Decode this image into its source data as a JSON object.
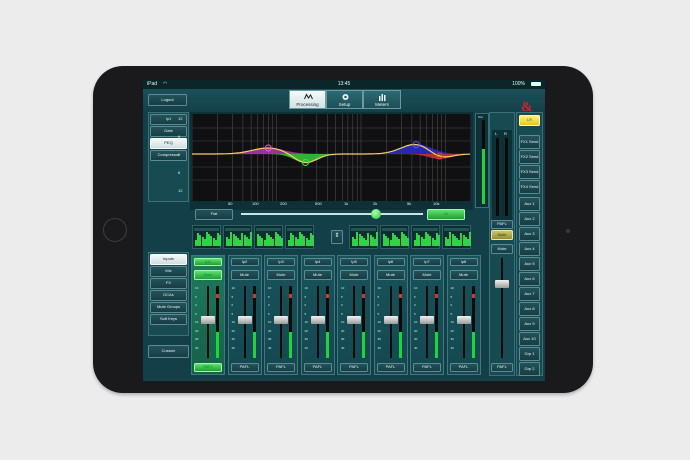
{
  "status_bar": {
    "device": "iPad",
    "wifi_icon": "wifi-icon",
    "time": "13:45",
    "battery": "100%",
    "battery_icon": "battery-icon"
  },
  "top_tabs": [
    {
      "label": "Processing",
      "icon": "waveform-icon",
      "active": true
    },
    {
      "label": "Setup",
      "icon": "gear-icon",
      "active": false
    },
    {
      "label": "Meters",
      "icon": "bars-icon",
      "active": false
    }
  ],
  "logout_label": "Logout",
  "logo_text": "&",
  "processing_menu": [
    "Ip1",
    "Gate",
    "PEQ",
    "Compressor"
  ],
  "processing_selected": "PEQ",
  "eq": {
    "db_labels": [
      "12",
      "6",
      "0",
      "6",
      "12"
    ],
    "freq_labels": [
      "50",
      "100",
      "200",
      "500",
      "1k",
      "2k",
      "5k",
      "10k"
    ],
    "flat_label": "Flat",
    "in_label": "In",
    "output_label": "Out"
  },
  "layer_menu": [
    "Inputs",
    "Mix",
    "FX",
    "DCAs",
    "Mute Groups",
    "Soft Keys"
  ],
  "layer_selected": "Inputs",
  "custom_label": "Custom",
  "scroll_button_icon": "up-down-icon",
  "channels": [
    {
      "name": "Ip1",
      "mute": "Mute",
      "pafl": "PAFL",
      "selected": true,
      "fader_level": 0.52
    },
    {
      "name": "Ip2",
      "mute": "Mute",
      "pafl": "PAFL",
      "selected": false,
      "fader_level": 0.52
    },
    {
      "name": "Ip3",
      "mute": "Mute",
      "pafl": "PAFL",
      "selected": false,
      "fader_level": 0.52
    },
    {
      "name": "Ip4",
      "mute": "Mute",
      "pafl": "PAFL",
      "selected": false,
      "fader_level": 0.52
    },
    {
      "name": "Ip5",
      "mute": "Mute",
      "pafl": "PAFL",
      "selected": false,
      "fader_level": 0.52
    },
    {
      "name": "Ip6",
      "mute": "Mute",
      "pafl": "PAFL",
      "selected": false,
      "fader_level": 0.52
    },
    {
      "name": "Ip7",
      "mute": "Mute",
      "pafl": "PAFL",
      "selected": false,
      "fader_level": 0.52
    },
    {
      "name": "Ip8",
      "mute": "Mute",
      "pafl": "PAFL",
      "selected": false,
      "fader_level": 0.52
    }
  ],
  "master": {
    "lr_label": "LR",
    "meter_labels": [
      "L",
      "R"
    ],
    "pafl_top": "PAFL",
    "mute_labels": [
      "Mute",
      "Mute"
    ],
    "pafl_bottom": "PAFL"
  },
  "sends": [
    "FX1 Send",
    "FX2 Send",
    "FX3 Send",
    "FX4 Send"
  ],
  "auxes": [
    "Aux 1",
    "Aux 2",
    "Aux 3",
    "Aux 4",
    "Aux 5",
    "Aux 6",
    "Aux 7",
    "Aux 8",
    "Aux 9",
    "Aux 10",
    "Grp 1",
    "Grp 2"
  ],
  "colors": {
    "screen_bg": "#123f48",
    "accent_green": "#1fc92d",
    "logo_red": "#e11d2b",
    "lr_yellow": "#f3dc3a"
  }
}
